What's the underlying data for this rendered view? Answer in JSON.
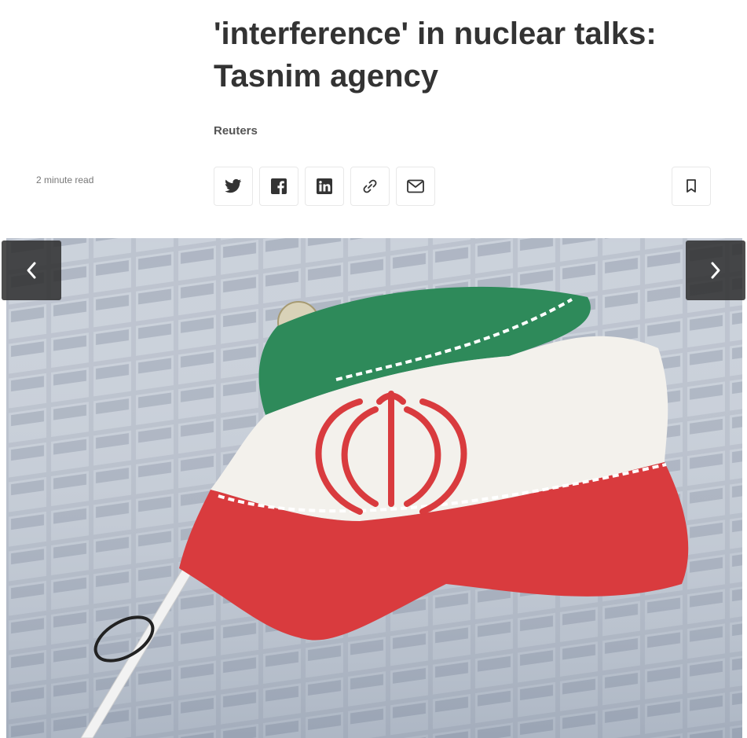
{
  "article": {
    "headline_line1": "'interference' in nuclear talks:",
    "headline_line2": "Tasnim agency",
    "byline": "Reuters",
    "read_time": "2 minute read"
  },
  "share_bar": {
    "buttons": [
      {
        "icon": "twitter-icon"
      },
      {
        "icon": "facebook-icon"
      },
      {
        "icon": "linkedin-icon"
      },
      {
        "icon": "link-icon"
      },
      {
        "icon": "email-icon"
      }
    ],
    "bookmark_icon": "bookmark-icon"
  },
  "gallery": {
    "prev_icon": "chevron-left-icon",
    "next_icon": "chevron-right-icon",
    "photo": "iran-flag-photo"
  },
  "colors": {
    "flag_green": "#2e8a5a",
    "flag_red": "#d93b3e",
    "nav_bg": "#2d2d2d"
  }
}
